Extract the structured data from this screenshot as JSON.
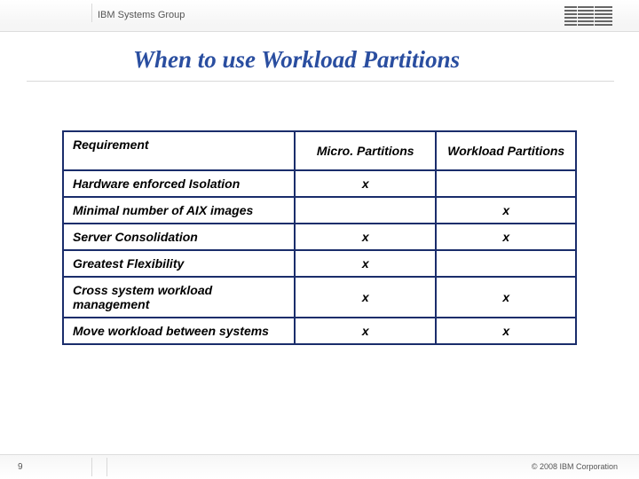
{
  "header": {
    "group": "IBM Systems Group",
    "logo_alt": "IBM"
  },
  "title": "When to use Workload Partitions",
  "table": {
    "headers": {
      "req": "Requirement",
      "col1": "Micro. Partitions",
      "col2": "Workload Partitions"
    },
    "rows": [
      {
        "req": "Hardware enforced Isolation",
        "c1": "x",
        "c2": ""
      },
      {
        "req": "Minimal number of AIX images",
        "c1": "",
        "c2": "x"
      },
      {
        "req": "Server Consolidation",
        "c1": "x",
        "c2": "x"
      },
      {
        "req": "Greatest Flexibility",
        "c1": "x",
        "c2": ""
      },
      {
        "req": "Cross system workload management",
        "c1": "x",
        "c2": "x"
      },
      {
        "req": "Move workload between systems",
        "c1": "x",
        "c2": "x"
      }
    ]
  },
  "footer": {
    "page": "9",
    "copyright": "© 2008 IBM Corporation"
  }
}
